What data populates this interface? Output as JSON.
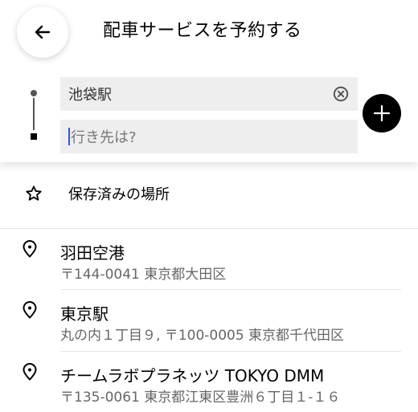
{
  "header": {
    "title": "配車サービスを予約する"
  },
  "route": {
    "pickup_value": "池袋駅",
    "destination_placeholder": "行き先は?"
  },
  "saved_places": {
    "label": "保存済みの場所"
  },
  "suggestions": [
    {
      "name": "羽田空港",
      "address": "〒144-0041 東京都大田区"
    },
    {
      "name": "東京駅",
      "address": "丸の内１丁目９, 〒100-0005 東京都千代田区"
    },
    {
      "name": "チームラボプラネッツ TOKYO DMM",
      "address": "〒135-0061 東京都江東区豊洲６丁目１-１６"
    }
  ],
  "icons": {
    "back": "arrow-left-icon",
    "clear": "clear-circle-icon",
    "add": "plus-icon",
    "saved": "star-icon",
    "place": "location-pin-icon"
  }
}
